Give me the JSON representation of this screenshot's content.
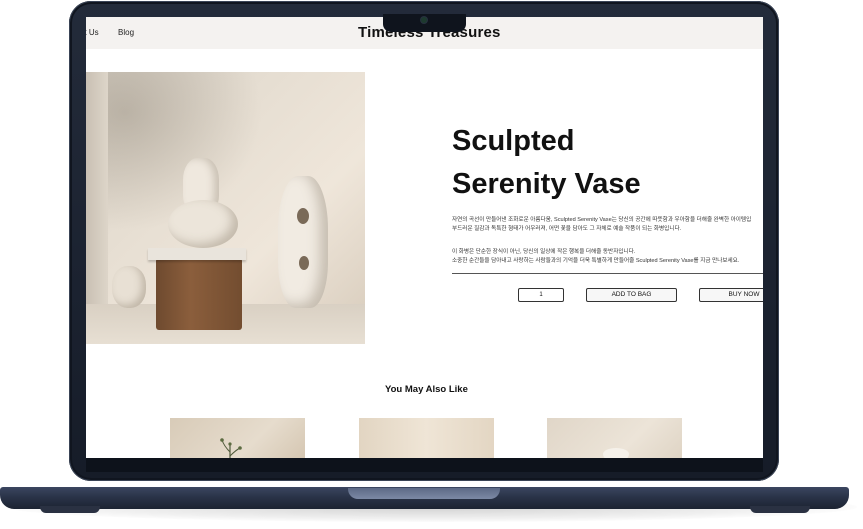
{
  "header": {
    "nav_about": "ut Us",
    "nav_blog": "Blog",
    "site_title": "Timeless Treasures"
  },
  "product": {
    "title_line1": "Sculpted",
    "title_line2": "Serenity Vase",
    "description": [
      "자연의 곡선이 만들어낸 조화로운 아름다움, Sculpted Serenity Vase는 당신의 공간에 따뜻함과 우아함을 더해줄 완벽한 아이템입",
      "부드러운 질감과 독특한 형태가 어우러져, 어떤 꽃을 담아도 그 자체로 예술 작품이 되는 화병입니다.",
      "이 화병은 단순한 장식이 아닌, 당신의 일상에 작은 행복을 더해줄 동반자입니다.",
      "소중한 순간들을 담아내고 사랑하는 사람들과의 기억을 더욱 특별하게 만들어줄 Sculpted Serenity Vase를 지금 만나보세요."
    ],
    "quantity": "1",
    "add_to_bag": "ADD TO BAG",
    "buy_now": "BUY NOW"
  },
  "recommendations": {
    "title": "You May Also Like"
  },
  "icons": {
    "camera": "camera-icon"
  }
}
